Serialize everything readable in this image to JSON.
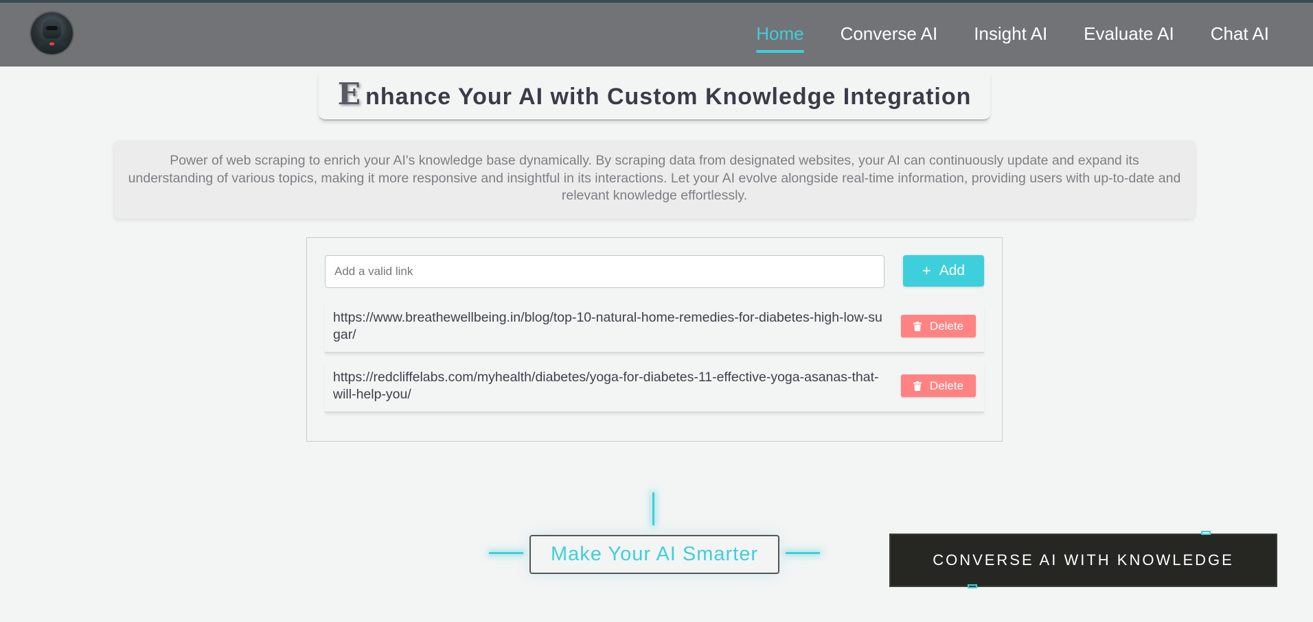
{
  "navbar": {
    "links": [
      {
        "label": "Home",
        "active": true
      },
      {
        "label": "Converse AI",
        "active": false
      },
      {
        "label": "Insight AI",
        "active": false
      },
      {
        "label": "Evaluate AI",
        "active": false
      },
      {
        "label": "Chat AI",
        "active": false
      }
    ]
  },
  "header": {
    "title_initial": "E",
    "title_rest": "nhance Your AI with Custom Knowledge Integration"
  },
  "description": "Power of web scraping to enrich your AI's knowledge base dynamically. By scraping data from designated websites, your AI can continuously update and expand its understanding of various topics, making it more responsive and insightful in its interactions. Let your AI evolve alongside real-time information, providing users with up-to-date and relevant knowledge effortlessly.",
  "link_form": {
    "input_placeholder": "Add a valid link",
    "input_value": "",
    "add_label": "Add",
    "delete_label": "Delete",
    "links": [
      "https://www.breathewellbeing.in/blog/top-10-natural-home-remedies-for-diabetes-high-low-sugar/",
      "https://redcliffelabs.com/myhealth/diabetes/yoga-for-diabetes-11-effective-yoga-asanas-that-will-help-you/"
    ]
  },
  "footer_cta": {
    "tagline": "Make Your AI Smarter",
    "button_label": "CONVERSE AI WITH KNOWLEDGE"
  },
  "colors": {
    "accent": "#3ecfdc",
    "navbar": "#727377",
    "delete": "#ff8383",
    "cta_background": "#262723"
  },
  "icons": [
    "avatar-image",
    "plus-icon",
    "trash-icon"
  ]
}
